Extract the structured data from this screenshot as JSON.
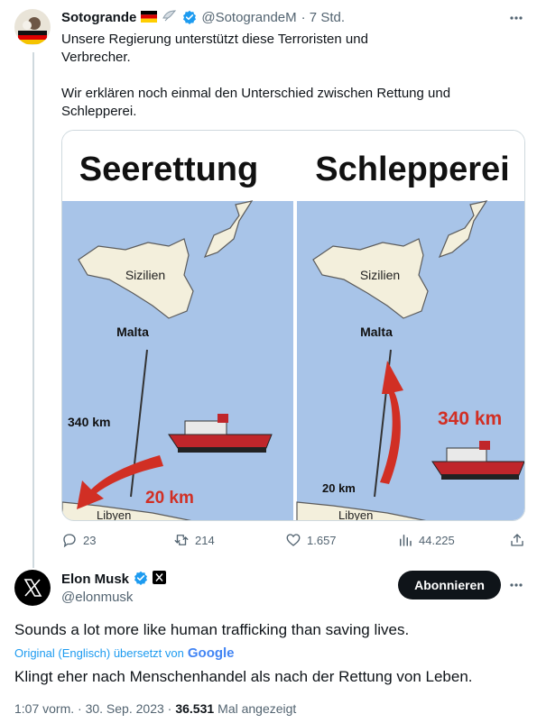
{
  "quoted_tweet": {
    "display_name": "Sotogrande",
    "handle": "@SotograndeM",
    "time": "· 7 Std.",
    "text_line1": "Unsere Regierung unterstützt diese Terroristen und",
    "text_line2": "Verbrecher.",
    "text_line3": "Wir erklären noch einmal den Unterschied zwischen Rettung und",
    "text_line4": "Schlepperei.",
    "image": {
      "left_title": "Seerettung",
      "right_title": "Schlepperei",
      "label_sicily": "Sizilien",
      "label_malta": "Malta",
      "label_libya": "Libyen",
      "left_far_distance": "340 km",
      "left_near_distance": "20 km",
      "right_far_distance": "340 km",
      "right_near_distance": "20 km"
    },
    "actions": {
      "replies": "23",
      "retweets": "214",
      "likes": "1.657",
      "views": "44.225"
    }
  },
  "main_tweet": {
    "display_name": "Elon Musk",
    "handle": "@elonmusk",
    "follow_label": "Abonnieren",
    "text": "Sounds a lot more like human trafficking than saving lives.",
    "translation_prefix": "Original (Englisch) übersetzt von",
    "translation_brand": "Google",
    "translated_text": "Klingt eher nach Menschenhandel als nach der Rettung von Leben.",
    "timestamp": "1:07 vorm. · 30. Sep. 2023 ·",
    "views_count": "36.531",
    "views_label": "Mal angezeigt"
  },
  "colors": {
    "sea": "#a8c4e8",
    "land": "#f3efdc",
    "arrow": "#d12f24",
    "verified": "#1d9bf0"
  }
}
